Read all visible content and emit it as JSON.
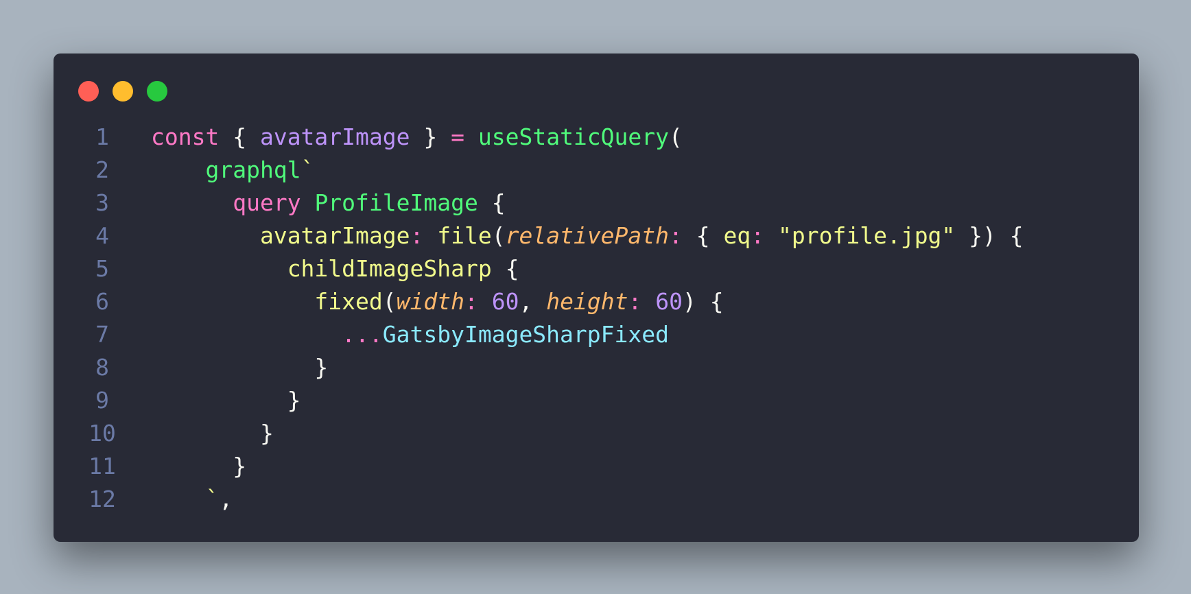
{
  "colors": {
    "background": "#a8b3be",
    "editor_background": "#282a36",
    "line_number": "#6b7aa6",
    "close_dot": "#ff5f56",
    "minimize_dot": "#ffbd2e",
    "maximize_dot": "#27c93f",
    "keyword": "#ff79c6",
    "variable": "#bd93f9",
    "function": "#50fa7b",
    "default": "#f8f8f2",
    "yellow": "#f1fa8c",
    "param": "#ffb86c",
    "type": "#8be9fd"
  },
  "window_controls": [
    {
      "name": "close-dot",
      "color": "#ff5f56"
    },
    {
      "name": "minimize-dot",
      "color": "#ffbd2e"
    },
    {
      "name": "maximize-dot",
      "color": "#27c93f"
    }
  ],
  "code_lines": [
    {
      "number": "1",
      "tokens": [
        {
          "text": "const",
          "color": "#ff79c6"
        },
        {
          "text": " { ",
          "color": "#f8f8f2"
        },
        {
          "text": "avatarImage",
          "color": "#bd93f9"
        },
        {
          "text": " } ",
          "color": "#f8f8f2"
        },
        {
          "text": "=",
          "color": "#ff79c6"
        },
        {
          "text": " ",
          "color": "#f8f8f2"
        },
        {
          "text": "useStaticQuery",
          "color": "#50fa7b"
        },
        {
          "text": "(",
          "color": "#f8f8f2"
        }
      ]
    },
    {
      "number": "2",
      "tokens": [
        {
          "text": "    ",
          "color": "#f8f8f2"
        },
        {
          "text": "graphql",
          "color": "#50fa7b"
        },
        {
          "text": "`",
          "color": "#f1fa8c"
        }
      ]
    },
    {
      "number": "3",
      "tokens": [
        {
          "text": "      ",
          "color": "#f8f8f2"
        },
        {
          "text": "query",
          "color": "#ff79c6"
        },
        {
          "text": " ",
          "color": "#f8f8f2"
        },
        {
          "text": "ProfileImage",
          "color": "#50fa7b"
        },
        {
          "text": " {",
          "color": "#f8f8f2"
        }
      ]
    },
    {
      "number": "4",
      "tokens": [
        {
          "text": "        ",
          "color": "#f8f8f2"
        },
        {
          "text": "avatarImage",
          "color": "#f1fa8c"
        },
        {
          "text": ":",
          "color": "#ff79c6"
        },
        {
          "text": " ",
          "color": "#f8f8f2"
        },
        {
          "text": "file",
          "color": "#f1fa8c"
        },
        {
          "text": "(",
          "color": "#f8f8f2"
        },
        {
          "text": "relativePath",
          "color": "#ffb86c",
          "italic": true
        },
        {
          "text": ":",
          "color": "#ff79c6"
        },
        {
          "text": " { ",
          "color": "#f8f8f2"
        },
        {
          "text": "eq",
          "color": "#f1fa8c"
        },
        {
          "text": ":",
          "color": "#ff79c6"
        },
        {
          "text": " ",
          "color": "#f8f8f2"
        },
        {
          "text": "\"profile.jpg\"",
          "color": "#f1fa8c"
        },
        {
          "text": " }) {",
          "color": "#f8f8f2"
        }
      ]
    },
    {
      "number": "5",
      "tokens": [
        {
          "text": "          ",
          "color": "#f8f8f2"
        },
        {
          "text": "childImageSharp",
          "color": "#f1fa8c"
        },
        {
          "text": " {",
          "color": "#f8f8f2"
        }
      ]
    },
    {
      "number": "6",
      "tokens": [
        {
          "text": "            ",
          "color": "#f8f8f2"
        },
        {
          "text": "fixed",
          "color": "#f1fa8c"
        },
        {
          "text": "(",
          "color": "#f8f8f2"
        },
        {
          "text": "width",
          "color": "#ffb86c",
          "italic": true
        },
        {
          "text": ":",
          "color": "#ff79c6"
        },
        {
          "text": " ",
          "color": "#f8f8f2"
        },
        {
          "text": "60",
          "color": "#bd93f9"
        },
        {
          "text": ", ",
          "color": "#f8f8f2"
        },
        {
          "text": "height",
          "color": "#ffb86c",
          "italic": true
        },
        {
          "text": ":",
          "color": "#ff79c6"
        },
        {
          "text": " ",
          "color": "#f8f8f2"
        },
        {
          "text": "60",
          "color": "#bd93f9"
        },
        {
          "text": ") {",
          "color": "#f8f8f2"
        }
      ]
    },
    {
      "number": "7",
      "tokens": [
        {
          "text": "              ",
          "color": "#f8f8f2"
        },
        {
          "text": "...",
          "color": "#ff79c6"
        },
        {
          "text": "GatsbyImageSharpFixed",
          "color": "#8be9fd"
        }
      ]
    },
    {
      "number": "8",
      "tokens": [
        {
          "text": "            }",
          "color": "#f8f8f2"
        }
      ]
    },
    {
      "number": "9",
      "tokens": [
        {
          "text": "          }",
          "color": "#f8f8f2"
        }
      ]
    },
    {
      "number": "10",
      "tokens": [
        {
          "text": "        }",
          "color": "#f8f8f2"
        }
      ]
    },
    {
      "number": "11",
      "tokens": [
        {
          "text": "      }",
          "color": "#f8f8f2"
        }
      ]
    },
    {
      "number": "12",
      "tokens": [
        {
          "text": "    `",
          "color": "#f1fa8c"
        },
        {
          "text": ",",
          "color": "#f8f8f2"
        }
      ]
    }
  ]
}
